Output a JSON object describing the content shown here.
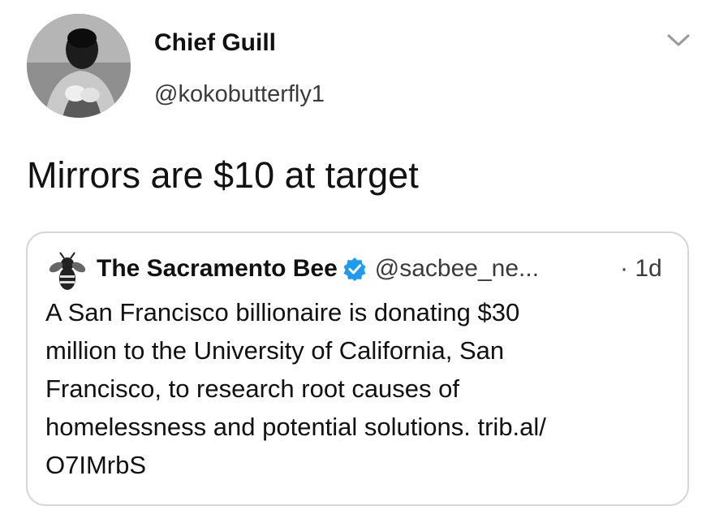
{
  "tweet": {
    "author": {
      "display_name": "Chief Guill",
      "handle": "@kokobutterfly1",
      "avatar_icon": "profile-photo"
    },
    "menu_icon": "chevron-down-icon",
    "text": "Mirrors are $10 at target",
    "quoted": {
      "author_name": "The Sacramento Bee",
      "verified_icon": "verified-badge-icon",
      "verified_color": "#1d9bf0",
      "author_handle": "@sacbee_ne...",
      "time": "· 1d",
      "text_lines": [
        "A San Francisco billionaire is donating $30",
        "million to the University of California, San",
        "Francisco, to research root causes of",
        "homelessness and potential solutions. trib.al/",
        "O7IMrbS"
      ]
    }
  },
  "colors": {
    "text": "#111111",
    "secondary_text": "#3b3b3b",
    "card_border": "#d6d6d6",
    "background": "#ffffff"
  }
}
